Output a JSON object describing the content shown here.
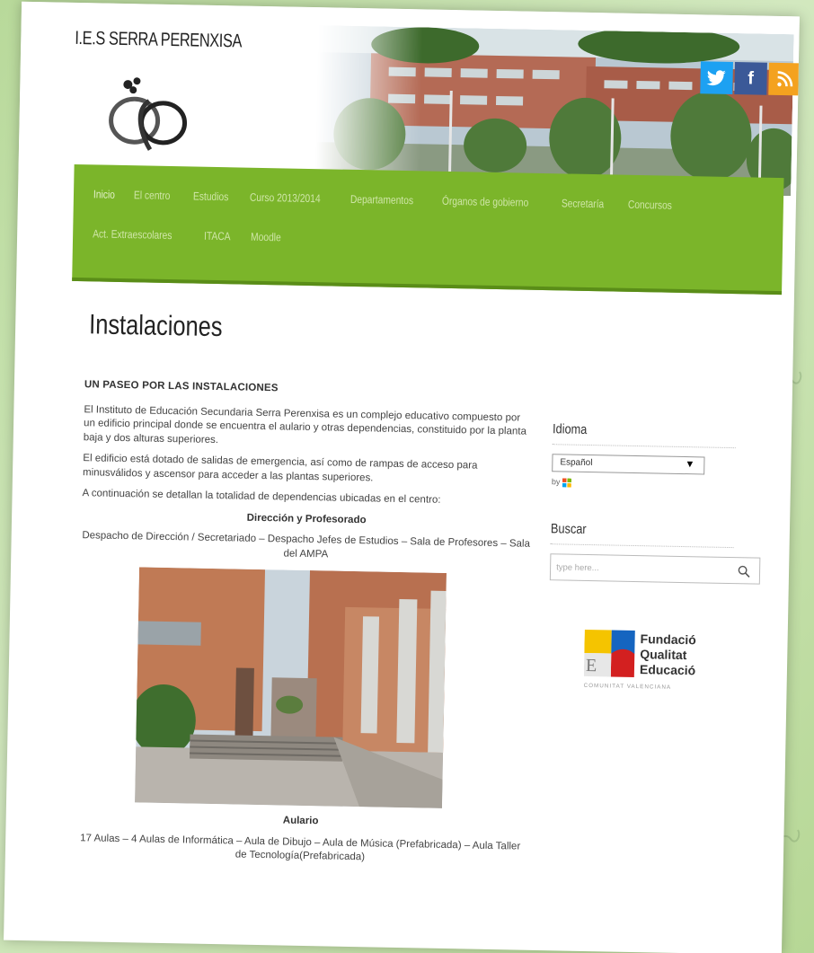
{
  "site": {
    "title": "I.E.S SERRA PERENXISA"
  },
  "social": [
    {
      "name": "twitter-icon",
      "glyph": "t",
      "color": "#1da1f2"
    },
    {
      "name": "facebook-icon",
      "glyph": "f",
      "color": "#3b5998"
    },
    {
      "name": "rss-icon",
      "glyph": "☰",
      "color": "#f4a21f"
    }
  ],
  "nav": {
    "items": [
      "Inicio",
      "El centro",
      "Estudios",
      "Curso 2013/2014",
      "Departamentos",
      "Órganos de gobierno",
      "Secretaría",
      "Concursos",
      "Act. Extraescolares",
      "ITACA",
      "Moodle"
    ]
  },
  "page": {
    "title": "Instalaciones"
  },
  "content": {
    "section_title": "UN PASEO POR LAS INSTALACIONES",
    "p1": "El Instituto de Educación Secundaria Serra Perenxisa es un complejo educativo compuesto por un edificio principal donde se encuentra el aulario y otras dependencias, constituido por la planta baja y dos alturas superiores.",
    "p2": "El edificio está dotado de salidas de emergencia, así como de rampas de acceso para minusválidos y ascensor para acceder a las plantas superiores.",
    "p3": "A continuación se detallan la totalidad de dependencias ubicadas en el centro:",
    "h_direccion": "Dirección y Profesorado",
    "direccion_text": "Despacho de Dirección / Secretariado – Despacho Jefes de Estudios  – Sala de Profesores  – Sala del AMPA",
    "caption": "Aulario",
    "aulario_text": "17 Aulas – 4 Aulas de Informática – Aula de Dibujo – Aula de Música (Prefabricada) – Aula Taller de Tecnología(Prefabricada)"
  },
  "sidebar": {
    "idioma_title": "Idioma",
    "idioma_selected": "Español",
    "by_label": "by",
    "buscar_title": "Buscar",
    "search_placeholder": "type here...",
    "fq_lines": [
      "Fundació",
      "Qualitat",
      "Educació"
    ],
    "fq_sub": "COMUNITAT VALENCIANA"
  },
  "colors": {
    "nav": "#7bb52a",
    "nav_text": "#cfe6a8"
  }
}
